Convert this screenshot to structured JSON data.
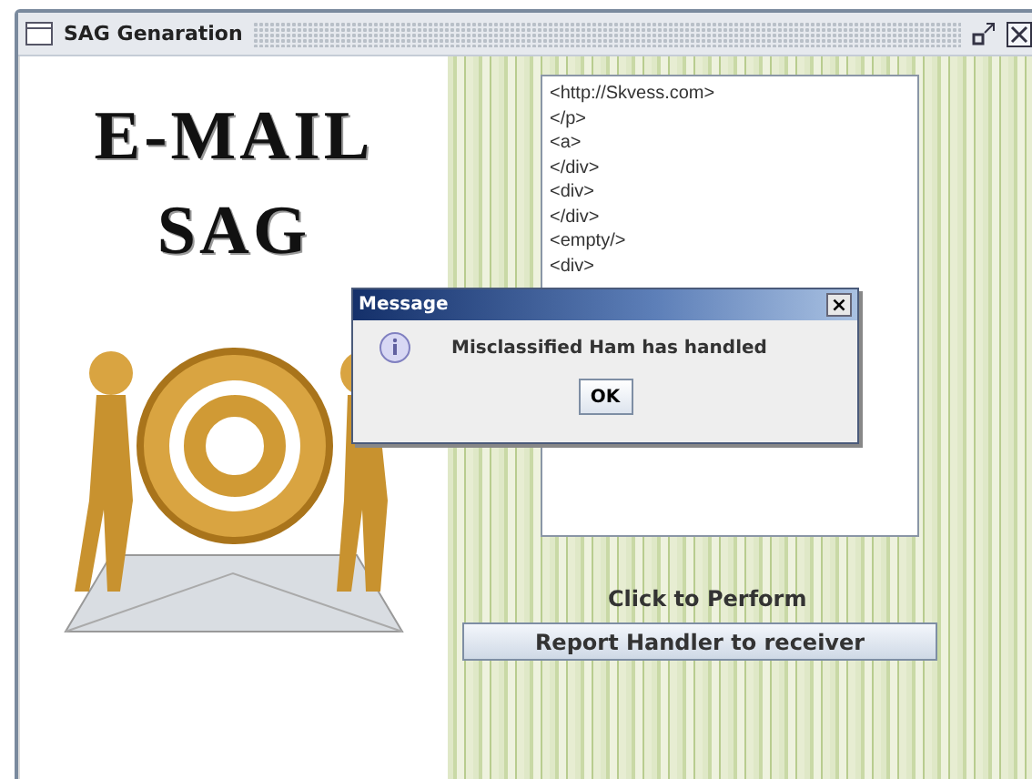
{
  "window": {
    "title": "SAG Genaration"
  },
  "logo": {
    "lines": [
      "E-MAIL",
      "SAG"
    ]
  },
  "xml_lines": [
    "<http://Skvess.com>",
    "</p>",
    "<a>",
    "</div>",
    "<div>",
    "</div>",
    "<empty/>",
    "<div>"
  ],
  "prompt": "Click to Perform",
  "action_button": "Report Handler to receiver",
  "dialog": {
    "title": "Message",
    "close": "×",
    "message": "Misclassified Ham has handled",
    "button": "OK"
  }
}
